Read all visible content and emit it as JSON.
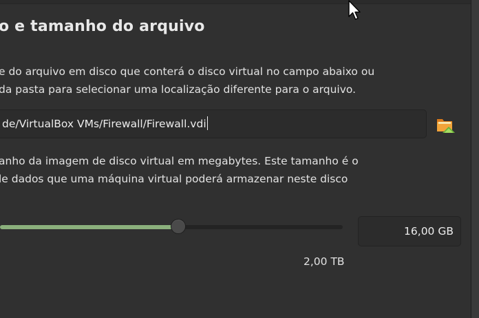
{
  "section": {
    "title": "o e tamanho do arquivo"
  },
  "location": {
    "description_lines": [
      "e do arquivo em disco que conterá o disco virtual no campo abaixo ou",
      "da pasta para selecionar uma localização diferente para o arquivo."
    ],
    "path_value": "de/VirtualBox VMs/Firewall/Firewall.vdi",
    "browse_icon": "folder-up-icon"
  },
  "size": {
    "description_lines": [
      "anho da imagem de disco virtual em megabytes. Este tamanho é o",
      "le dados que uma máquina virtual poderá armazenar neste disco"
    ],
    "slider_fraction": 0.52,
    "value": "16,00 GB",
    "max_label": "2,00 TB"
  },
  "colors": {
    "background": "#303030",
    "slider_fill": "#8bb07c",
    "text": "#e2e2e2"
  },
  "cursor_icon": "mouse-pointer-icon"
}
